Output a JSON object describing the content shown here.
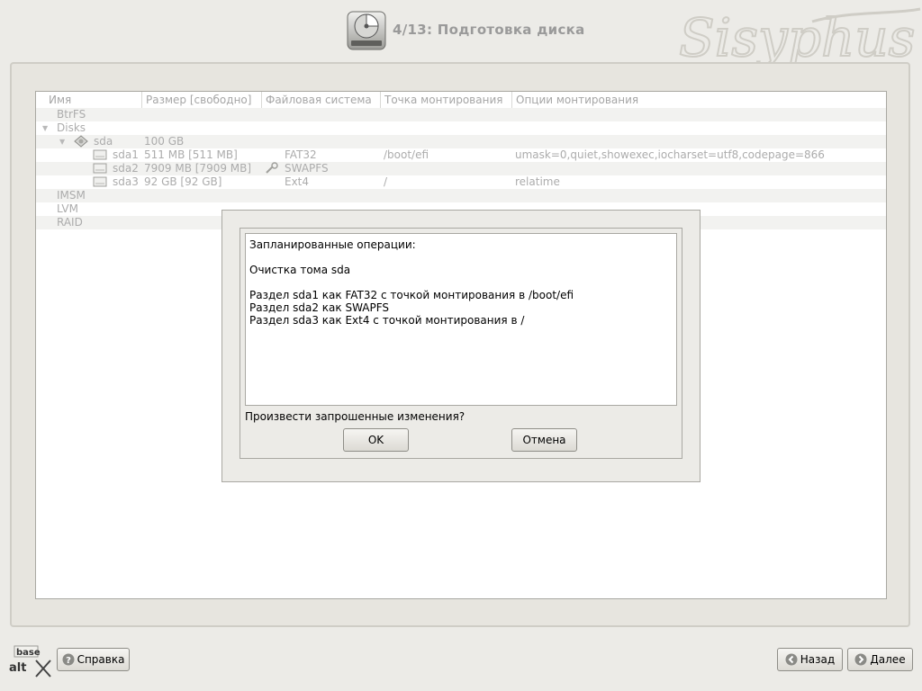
{
  "header": {
    "title": "4/13: Подготовка диска",
    "icon": "disk-drive-icon",
    "brand": "Sisyphus"
  },
  "tree": {
    "columns": [
      "Имя",
      "Размер [свободно]",
      "Файловая система",
      "Точка монтирования",
      "Опции монтирования"
    ],
    "rows": [
      {
        "name": "BtrFS",
        "size": "",
        "fs": "",
        "mount": "",
        "options": ""
      },
      {
        "name": "Disks",
        "size": "",
        "fs": "",
        "mount": "",
        "options": ""
      },
      {
        "name": "sda",
        "size": "100 GB",
        "fs": "",
        "mount": "",
        "options": ""
      },
      {
        "name": "sda1",
        "size": "511 MB [511 MB]",
        "fs": "FAT32",
        "mount": "/boot/efi",
        "options": "umask=0,quiet,showexec,iocharset=utf8,codepage=866"
      },
      {
        "name": "sda2",
        "size": "7909 MB [7909 MB]",
        "fs": "SWAPFS",
        "mount": "",
        "options": ""
      },
      {
        "name": "sda3",
        "size": "92 GB [92 GB]",
        "fs": "Ext4",
        "mount": "/",
        "options": "relatime"
      },
      {
        "name": "IMSM",
        "size": "",
        "fs": "",
        "mount": "",
        "options": ""
      },
      {
        "name": "LVM",
        "size": "",
        "fs": "",
        "mount": "",
        "options": ""
      },
      {
        "name": "RAID",
        "size": "",
        "fs": "",
        "mount": "",
        "options": ""
      }
    ]
  },
  "dialog": {
    "operations": [
      "Запланированные операции:",
      "",
      "Очистка тома sda",
      "",
      "Раздел sda1 как FAT32 с точкой монтирования в /boot/efi",
      "Раздел sda2 как SWAPFS",
      "Раздел sda3 как Ext4 с точкой монтирования в /"
    ],
    "question": "Произвести запрошенные изменения?",
    "ok_label": "OK",
    "cancel_label": "Отмена"
  },
  "footer": {
    "logo_top": "base",
    "logo_bottom": "alt",
    "help_label": "Справка",
    "back_label": "Назад",
    "next_label": "Далее"
  }
}
